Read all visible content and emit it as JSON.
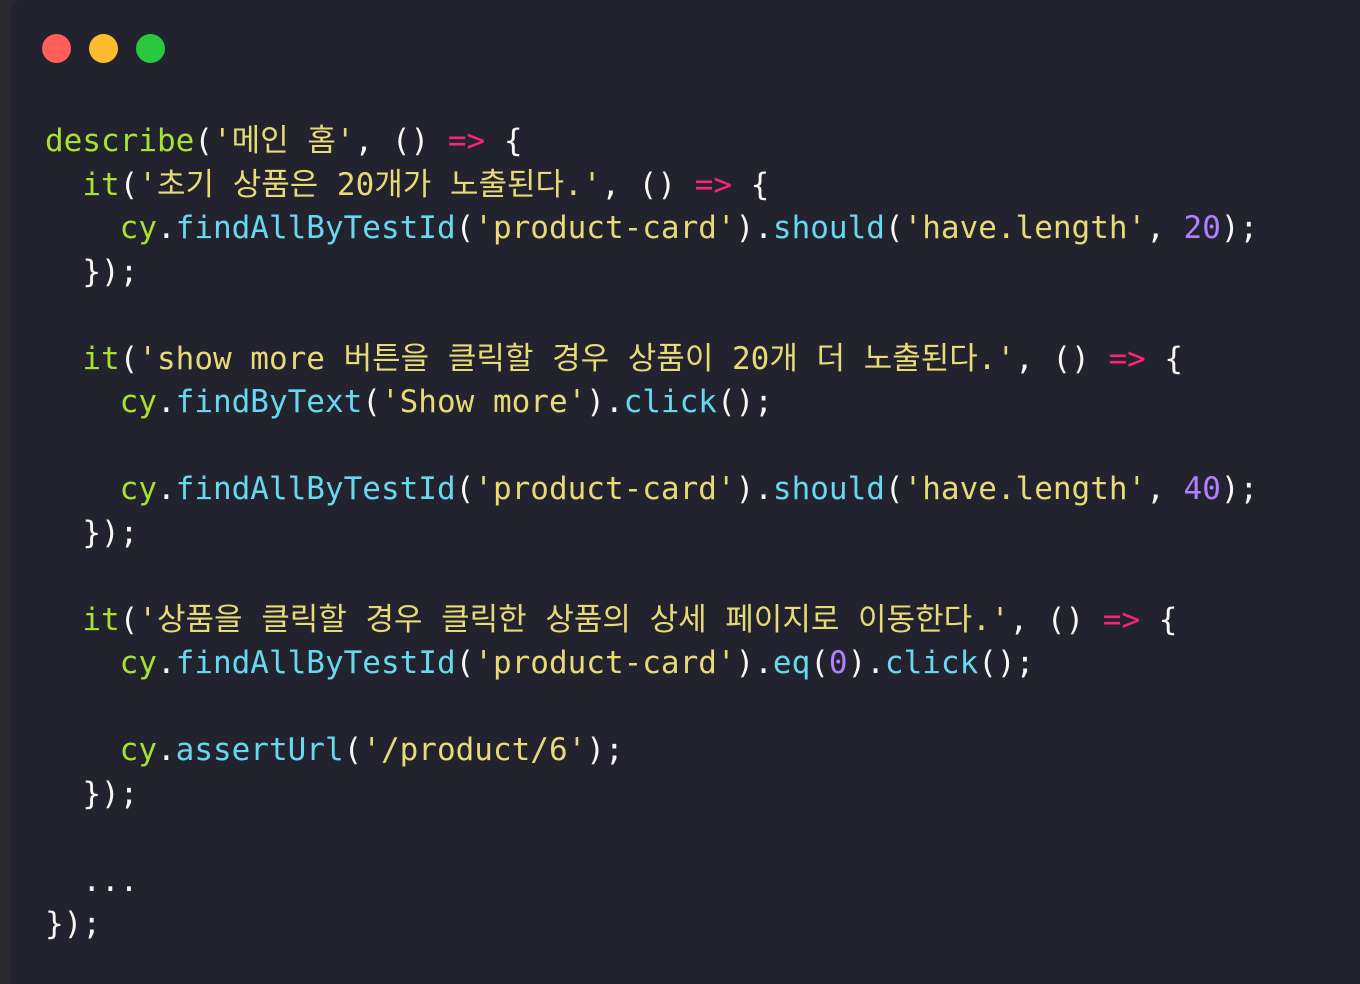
{
  "window": {
    "controls": [
      {
        "name": "close",
        "color": "#ff5f57"
      },
      {
        "name": "minimize",
        "color": "#febc2e"
      },
      {
        "name": "maximize",
        "color": "#28c840"
      }
    ]
  },
  "colors": {
    "background": "#23232f",
    "function": "#a6e22e",
    "object": "#66d9ef",
    "string": "#e6db74",
    "number": "#ae81ff",
    "arrow": "#f92672",
    "punctuation": "#f8f8f2"
  },
  "code": {
    "lines": [
      [
        {
          "t": "describe",
          "c": "fn"
        },
        {
          "t": "(",
          "c": "pun"
        },
        {
          "t": "'메인 홈'",
          "c": "str"
        },
        {
          "t": ", () ",
          "c": "pun"
        },
        {
          "t": "=>",
          "c": "arrow"
        },
        {
          "t": " {",
          "c": "pun"
        }
      ],
      [
        {
          "t": "  ",
          "c": "pun"
        },
        {
          "t": "it",
          "c": "fn"
        },
        {
          "t": "(",
          "c": "pun"
        },
        {
          "t": "'초기 상품은 20개가 노출된다.'",
          "c": "str"
        },
        {
          "t": ", () ",
          "c": "pun"
        },
        {
          "t": "=>",
          "c": "arrow"
        },
        {
          "t": " {",
          "c": "pun"
        }
      ],
      [
        {
          "t": "    ",
          "c": "pun"
        },
        {
          "t": "cy",
          "c": "fn"
        },
        {
          "t": ".",
          "c": "pun"
        },
        {
          "t": "findAllByTestId",
          "c": "obj"
        },
        {
          "t": "(",
          "c": "pun"
        },
        {
          "t": "'product-card'",
          "c": "str"
        },
        {
          "t": ").",
          "c": "pun"
        },
        {
          "t": "should",
          "c": "obj"
        },
        {
          "t": "(",
          "c": "pun"
        },
        {
          "t": "'have.length'",
          "c": "str"
        },
        {
          "t": ", ",
          "c": "pun"
        },
        {
          "t": "20",
          "c": "num"
        },
        {
          "t": ");",
          "c": "pun"
        }
      ],
      [
        {
          "t": "  });",
          "c": "pun"
        }
      ],
      [],
      [
        {
          "t": "  ",
          "c": "pun"
        },
        {
          "t": "it",
          "c": "fn"
        },
        {
          "t": "(",
          "c": "pun"
        },
        {
          "t": "'show more 버튼을 클릭할 경우 상품이 20개 더 노출된다.'",
          "c": "str"
        },
        {
          "t": ", () ",
          "c": "pun"
        },
        {
          "t": "=>",
          "c": "arrow"
        },
        {
          "t": " {",
          "c": "pun"
        }
      ],
      [
        {
          "t": "    ",
          "c": "pun"
        },
        {
          "t": "cy",
          "c": "fn"
        },
        {
          "t": ".",
          "c": "pun"
        },
        {
          "t": "findByText",
          "c": "obj"
        },
        {
          "t": "(",
          "c": "pun"
        },
        {
          "t": "'Show more'",
          "c": "str"
        },
        {
          "t": ").",
          "c": "pun"
        },
        {
          "t": "click",
          "c": "obj"
        },
        {
          "t": "();",
          "c": "pun"
        }
      ],
      [],
      [
        {
          "t": "    ",
          "c": "pun"
        },
        {
          "t": "cy",
          "c": "fn"
        },
        {
          "t": ".",
          "c": "pun"
        },
        {
          "t": "findAllByTestId",
          "c": "obj"
        },
        {
          "t": "(",
          "c": "pun"
        },
        {
          "t": "'product-card'",
          "c": "str"
        },
        {
          "t": ").",
          "c": "pun"
        },
        {
          "t": "should",
          "c": "obj"
        },
        {
          "t": "(",
          "c": "pun"
        },
        {
          "t": "'have.length'",
          "c": "str"
        },
        {
          "t": ", ",
          "c": "pun"
        },
        {
          "t": "40",
          "c": "num"
        },
        {
          "t": ");",
          "c": "pun"
        }
      ],
      [
        {
          "t": "  });",
          "c": "pun"
        }
      ],
      [],
      [
        {
          "t": "  ",
          "c": "pun"
        },
        {
          "t": "it",
          "c": "fn"
        },
        {
          "t": "(",
          "c": "pun"
        },
        {
          "t": "'상품을 클릭할 경우 클릭한 상품의 상세 페이지로 이동한다.'",
          "c": "str"
        },
        {
          "t": ", () ",
          "c": "pun"
        },
        {
          "t": "=>",
          "c": "arrow"
        },
        {
          "t": " {",
          "c": "pun"
        }
      ],
      [
        {
          "t": "    ",
          "c": "pun"
        },
        {
          "t": "cy",
          "c": "fn"
        },
        {
          "t": ".",
          "c": "pun"
        },
        {
          "t": "findAllByTestId",
          "c": "obj"
        },
        {
          "t": "(",
          "c": "pun"
        },
        {
          "t": "'product-card'",
          "c": "str"
        },
        {
          "t": ").",
          "c": "pun"
        },
        {
          "t": "eq",
          "c": "obj"
        },
        {
          "t": "(",
          "c": "pun"
        },
        {
          "t": "0",
          "c": "num"
        },
        {
          "t": ").",
          "c": "pun"
        },
        {
          "t": "click",
          "c": "obj"
        },
        {
          "t": "();",
          "c": "pun"
        }
      ],
      [],
      [
        {
          "t": "    ",
          "c": "pun"
        },
        {
          "t": "cy",
          "c": "fn"
        },
        {
          "t": ".",
          "c": "pun"
        },
        {
          "t": "assertUrl",
          "c": "obj"
        },
        {
          "t": "(",
          "c": "pun"
        },
        {
          "t": "'/product/6'",
          "c": "str"
        },
        {
          "t": ");",
          "c": "pun"
        }
      ],
      [
        {
          "t": "  });",
          "c": "pun"
        }
      ],
      [],
      [
        {
          "t": "  ...",
          "c": "pun"
        }
      ],
      [
        {
          "t": "});",
          "c": "pun"
        }
      ]
    ]
  }
}
